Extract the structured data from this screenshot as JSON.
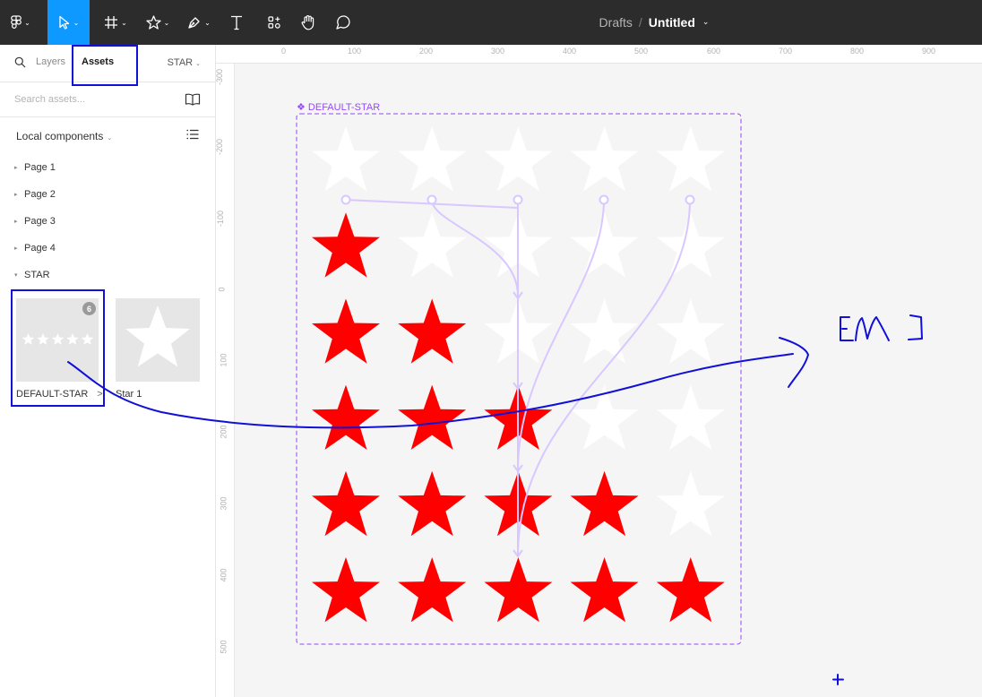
{
  "toolbar": {
    "tools": [
      {
        "name": "main-menu",
        "icon": "figma-logo-icon",
        "caret": "⌄"
      },
      {
        "name": "move-tool",
        "icon": "move-cursor-icon",
        "caret": "⌄",
        "active": true
      },
      {
        "name": "frame-tool",
        "icon": "frame-hash-icon",
        "caret": "⌄"
      },
      {
        "name": "shape-tool",
        "icon": "star-shape-icon",
        "caret": "⌄"
      },
      {
        "name": "pen-tool",
        "icon": "pen-icon",
        "caret": "⌄"
      },
      {
        "name": "text-tool",
        "icon": "text-t-icon"
      },
      {
        "name": "resources-tool",
        "icon": "resources-icon"
      },
      {
        "name": "hand-tool",
        "icon": "hand-icon"
      },
      {
        "name": "comment-tool",
        "icon": "comment-bubble-icon"
      }
    ],
    "breadcrumb_folder": "Drafts",
    "breadcrumb_sep": "/",
    "file_name": "Untitled",
    "file_chevron": "⌄",
    "active_color": "#0d99ff"
  },
  "panel": {
    "tabs": {
      "layers": "Layers",
      "assets": "Assets",
      "active": "Assets"
    },
    "page_selector": "STAR",
    "page_selector_caret": "⌄",
    "search_placeholder": "Search assets...",
    "library_icon": "book-icon",
    "local_components": "Local components",
    "local_components_caret": "⌄",
    "list_view_icon": "list-icon",
    "collapsed_marker": "▸",
    "expanded_marker": "▾",
    "pages": [
      "Page 1",
      "Page 2",
      "Page 3",
      "Page 4"
    ],
    "group": "STAR",
    "components": [
      {
        "name": "DEFAULT-STAR",
        "variant_count": "6",
        "arrow": ">"
      },
      {
        "name": "Star 1"
      }
    ]
  },
  "rulers": {
    "horizontal": [
      "0",
      "100",
      "200",
      "300",
      "400",
      "500",
      "600",
      "700",
      "800",
      "900"
    ],
    "vertical": [
      "-300",
      "-200",
      "-100",
      "0",
      "100",
      "200",
      "300",
      "400",
      "500"
    ]
  },
  "canvas": {
    "component_set_label": "❖ DEFAULT-STAR",
    "star_grid_filled_counts": [
      0,
      1,
      2,
      3,
      4,
      5
    ],
    "star_columns": 5,
    "filled_color": "#ff0000",
    "empty_color": "#ffffff",
    "frame_color": "#9747ff",
    "annotation_color": "#1010d8",
    "annotation_text": "[M]"
  }
}
